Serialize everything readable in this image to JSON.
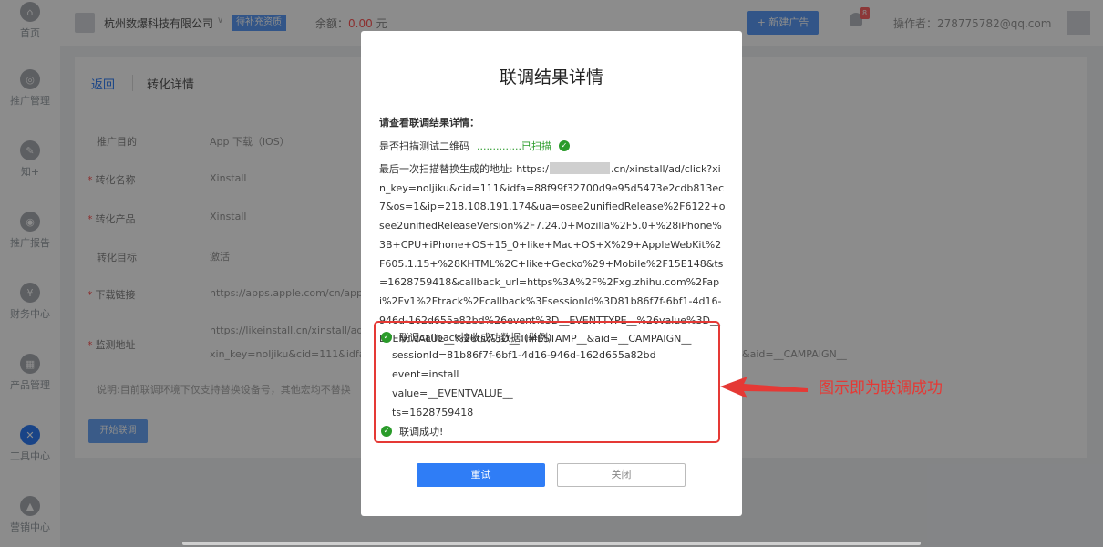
{
  "sidebar": {
    "items": [
      {
        "label": "首页",
        "icon": "home-icon"
      },
      {
        "label": "推广管理",
        "icon": "promotion-icon"
      },
      {
        "label": "知+",
        "icon": "edit-icon"
      },
      {
        "label": "推广报告",
        "icon": "report-icon"
      },
      {
        "label": "财务中心",
        "icon": "yen-icon"
      },
      {
        "label": "产品管理",
        "icon": "product-icon"
      },
      {
        "label": "工具中心",
        "icon": "tools-icon"
      },
      {
        "label": "营销中心",
        "icon": "marketing-icon"
      }
    ]
  },
  "header": {
    "company": "杭州数爆科技有限公司",
    "badge": "待补充资质",
    "balance_label": "余额：",
    "balance_value": "0.00",
    "balance_unit": "元",
    "new_ad": "+ 新建广告",
    "notification_count": "8",
    "operator": "操作者：278775782@qq.com"
  },
  "page": {
    "back": "返回",
    "title": "转化详情",
    "fields": [
      {
        "label": "推广目的",
        "value": "App 下载（iOS）",
        "required": false
      },
      {
        "label": "转化名称",
        "value": "Xinstall",
        "required": true
      },
      {
        "label": "转化产品",
        "value": "Xinstall",
        "required": true
      },
      {
        "label": "转化目标",
        "value": "激活",
        "required": false
      },
      {
        "label": "下载链接",
        "value": "https://apps.apple.com/cn/app/xi",
        "required": true
      },
      {
        "label": "监测地址",
        "value": "https://likeinstall.cn/xinstall/ad/clic",
        "required": true
      }
    ],
    "monitor_line2": "xin_key=noljiku&cid=111&idfa=__",
    "monitor_tail": "&aid=__CAMPAIGN__",
    "note": "说明:目前联调环境下仅支持替换设备号，其他宏均不替换",
    "start": "开始联调"
  },
  "modal": {
    "title": "联调结果详情",
    "subtitle": "请查看联调结果详情：",
    "scan_label": "是否扫描测试二维码",
    "scan_status": "..............已扫描",
    "address_prefix": "最后一次扫描替换生成的地址: https:/",
    "address_rest": ".cn/xinstall/ad/click?xin_key=noljiku&cid=111&idfa=88f99f32700d9e95d5473e2cdb813ec7&os=1&ip=218.108.191.174&ua=osee2unifiedRelease%2F6122+osee2unifiedReleaseVersion%2F7.24.0+Mozilla%2F5.0+%28iPhone%3B+CPU+iPhone+OS+15_0+like+Mac+OS+X%29+AppleWebKit%2F605.1.15+%28KHTML%2C+like+Gecko%29+Mobile%2F15E148&ts=1628759418&callback_url=https%3A%2F%2Fxg.zhihu.com%2Fapi%2Fv1%2Ftrack%2Fcallback%3FsessionId%3D81b86f7f-6bf1-4d16-946d-162d655a82bd%26event%3D__EVENTTYPE__%26value%3D__EVENTVALUE__%26ts%3D__TIMESTAMP__&aid=__CAMPAIGN__",
    "result_title": "联调callback接收成功数据:(举例)",
    "result_lines": [
      "sessionId=81b86f7f-6bf1-4d16-946d-162d655a82bd",
      "event=install",
      "value=__EVENTVALUE__",
      "ts=1628759418"
    ],
    "success": "联调成功!",
    "retry": "重试",
    "close": "关闭"
  },
  "annotation": {
    "text": "图示即为联调成功",
    "color": "#e53935"
  },
  "colors": {
    "primary": "#2f7df6",
    "success": "#2a9b2a",
    "highlight": "#e53935"
  }
}
